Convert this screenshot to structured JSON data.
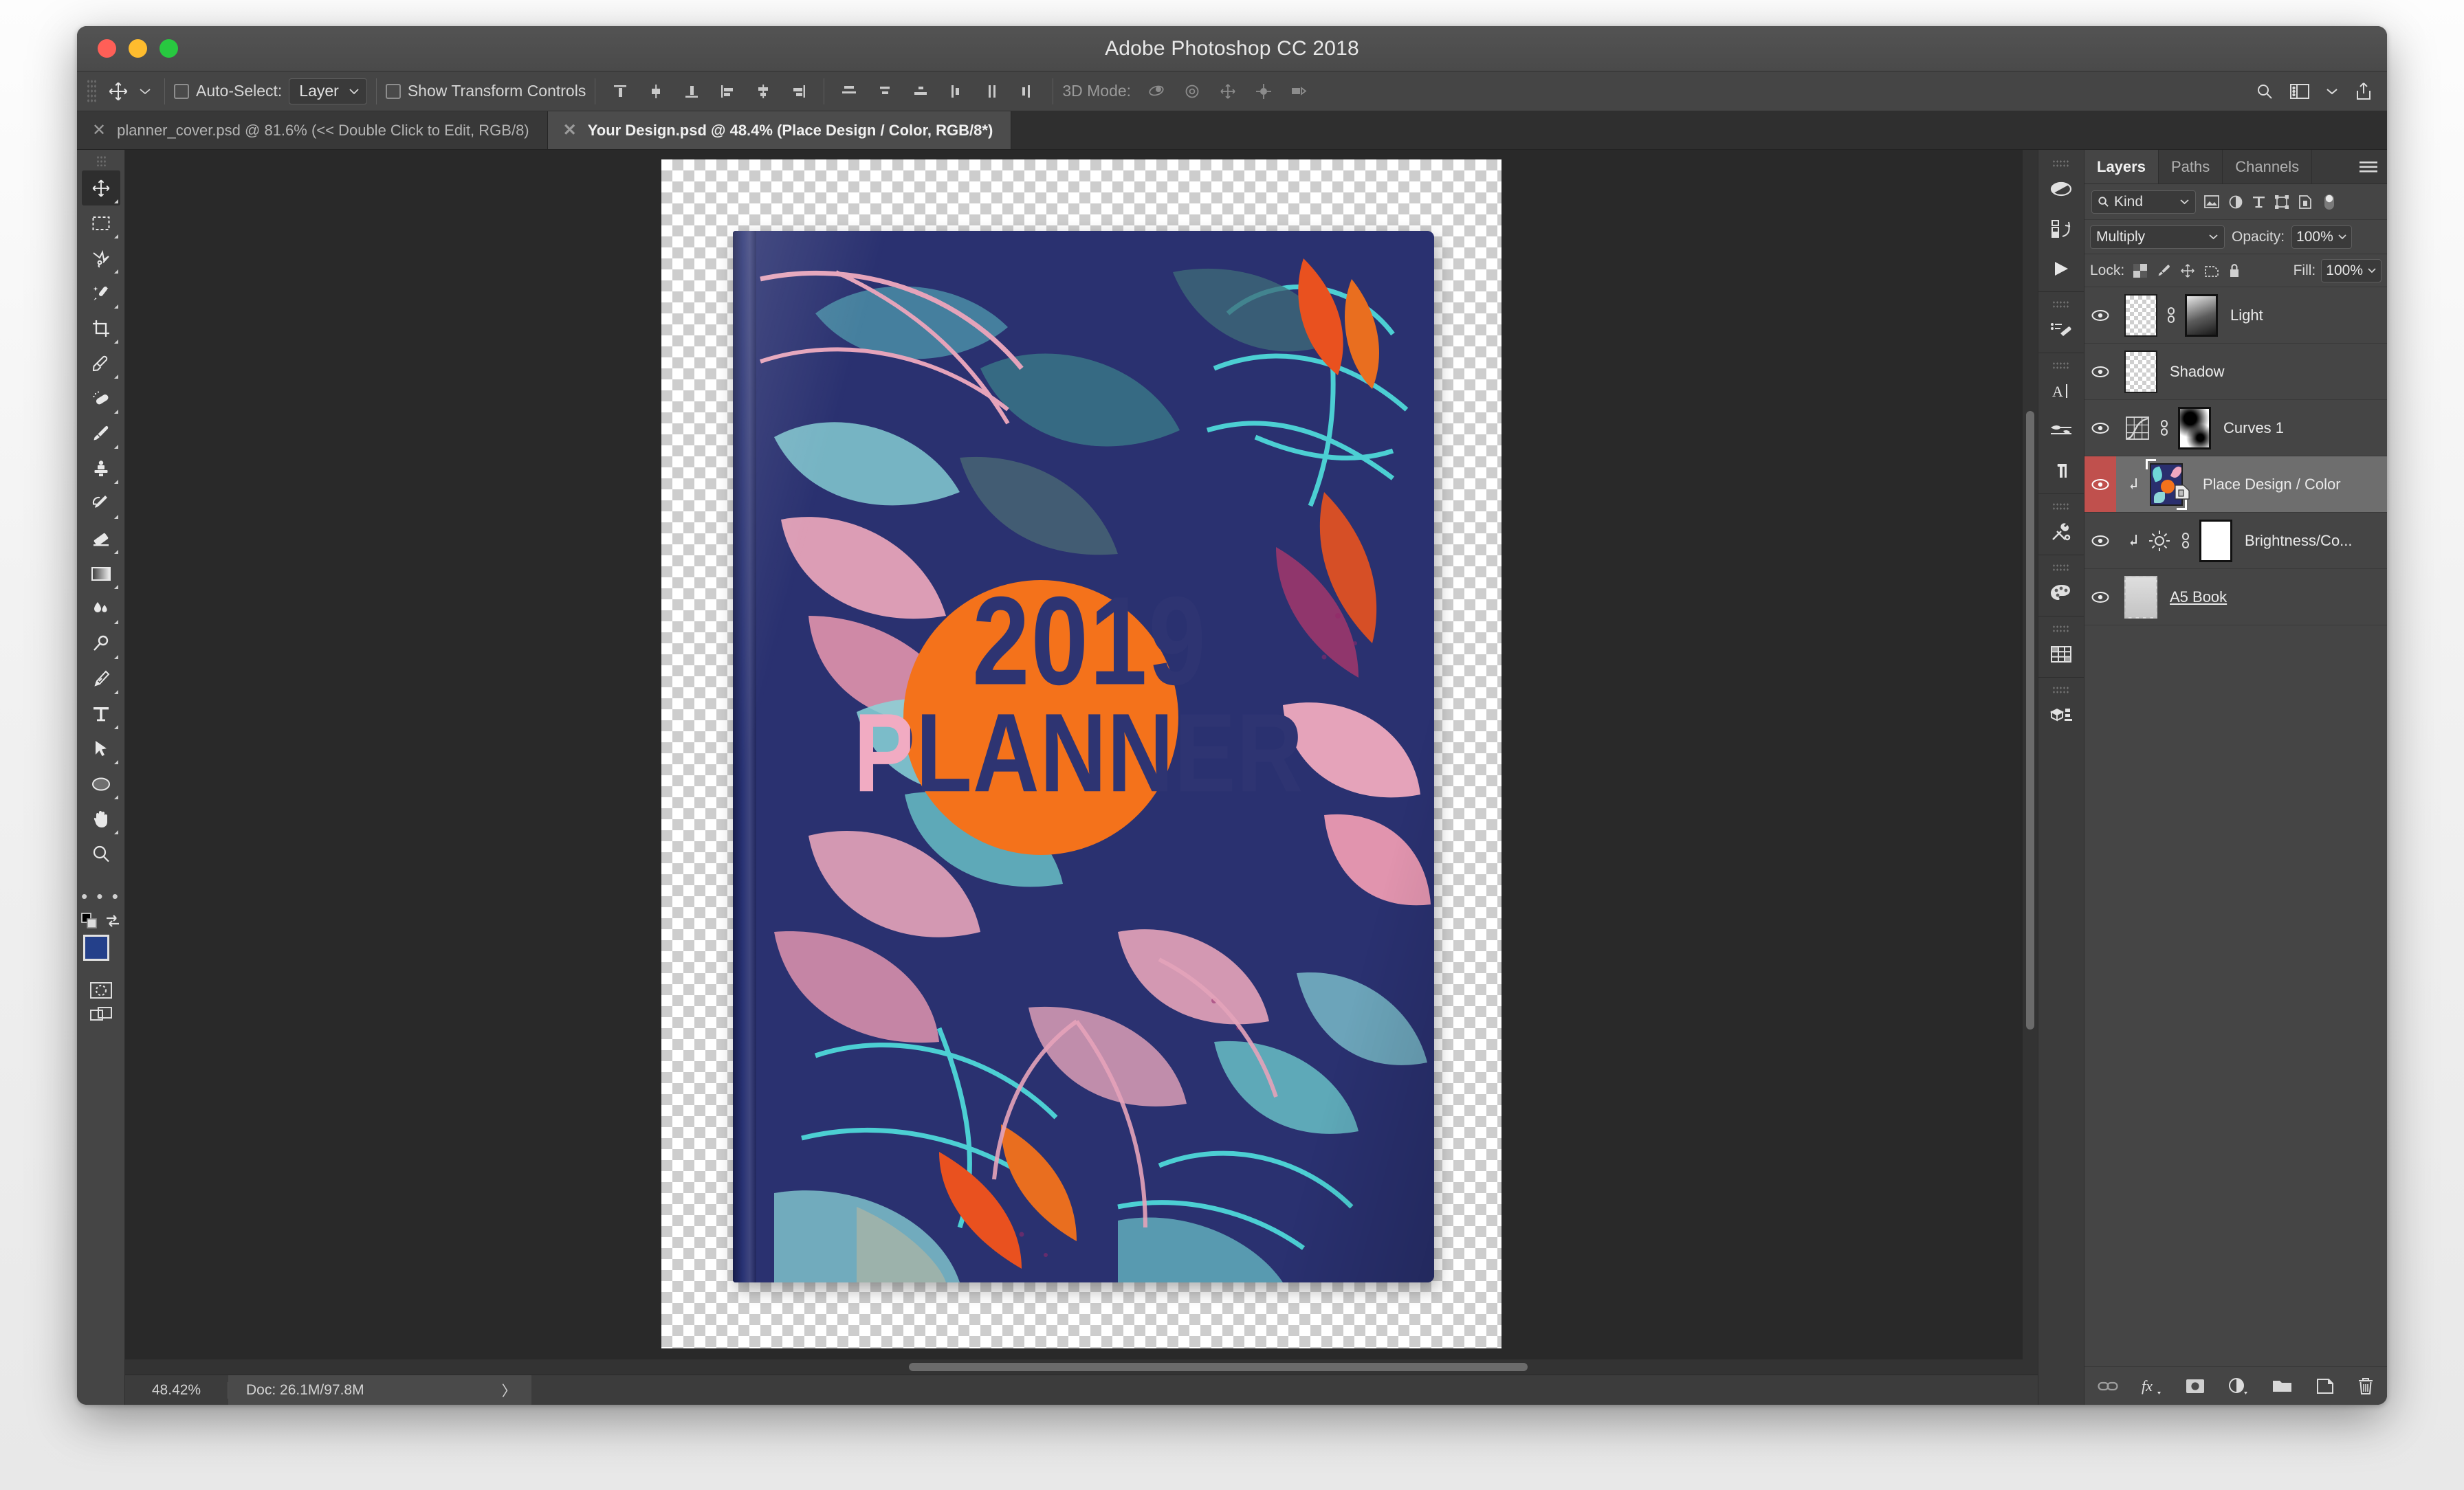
{
  "window": {
    "title": "Adobe Photoshop CC 2018",
    "traffic": {
      "close": "close-button",
      "minimize": "minimize-button",
      "zoom": "zoom-button"
    }
  },
  "options_bar": {
    "auto_select_label": "Auto-Select:",
    "auto_select_value": "Layer",
    "show_transform_label": "Show Transform Controls",
    "mode_3d_label": "3D Mode:",
    "align_icons": [
      "align-top-edges-icon",
      "align-vertical-centers-icon",
      "align-bottom-edges-icon",
      "align-left-edges-icon",
      "align-horizontal-centers-icon",
      "align-right-edges-icon"
    ],
    "distribute_icons": [
      "distribute-top-edges-icon",
      "distribute-vertical-centers-icon",
      "distribute-bottom-edges-icon",
      "distribute-left-edges-icon",
      "distribute-horizontal-centers-icon",
      "distribute-right-edges-icon"
    ],
    "mode_3d_icons": [
      "orbit-3d-icon",
      "roll-3d-icon",
      "pan-3d-icon",
      "slide-3d-icon",
      "camera-3d-icon"
    ],
    "right_icons": [
      "search-icon",
      "workspace-icon",
      "chevron-down-icon",
      "share-icon"
    ]
  },
  "tabs": [
    {
      "label": "planner_cover.psd @ 81.6% (<< Double Click to Edit, RGB/8)",
      "active": false
    },
    {
      "label": "Your Design.psd @ 48.4% (Place Design / Color, RGB/8*)",
      "active": true
    }
  ],
  "toolbar": {
    "tools": [
      {
        "name": "move-tool",
        "selected": true,
        "submenu": true
      },
      {
        "name": "rectangular-marquee-tool",
        "selected": false,
        "submenu": true
      },
      {
        "name": "lasso-tool",
        "selected": false,
        "submenu": true
      },
      {
        "name": "magic-wand-tool",
        "selected": false,
        "submenu": true
      },
      {
        "name": "crop-tool",
        "selected": false,
        "submenu": true
      },
      {
        "name": "eyedropper-tool",
        "selected": false,
        "submenu": true
      },
      {
        "name": "healing-brush-tool",
        "selected": false,
        "submenu": true
      },
      {
        "name": "brush-tool",
        "selected": false,
        "submenu": true
      },
      {
        "name": "clone-stamp-tool",
        "selected": false,
        "submenu": true
      },
      {
        "name": "history-brush-tool",
        "selected": false,
        "submenu": true
      },
      {
        "name": "eraser-tool",
        "selected": false,
        "submenu": true
      },
      {
        "name": "gradient-tool",
        "selected": false,
        "submenu": true
      },
      {
        "name": "blur-tool",
        "selected": false,
        "submenu": true
      },
      {
        "name": "dodge-tool",
        "selected": false,
        "submenu": true
      },
      {
        "name": "pen-tool",
        "selected": false,
        "submenu": true
      },
      {
        "name": "type-tool",
        "selected": false,
        "submenu": true
      },
      {
        "name": "path-selection-tool",
        "selected": false,
        "submenu": true
      },
      {
        "name": "ellipse-shape-tool",
        "selected": false,
        "submenu": true
      },
      {
        "name": "hand-tool",
        "selected": false,
        "submenu": true
      },
      {
        "name": "zoom-tool",
        "selected": false,
        "submenu": false
      }
    ],
    "more_tools": "• • •",
    "foreground_color": "#24408a",
    "background_color": "#000000",
    "quick_mask_icon": "quick-mask-icon",
    "screen_mode_icon": "screen-mode-icon",
    "swap_colors_icon": "swap-colors-icon",
    "default_colors_icon": "default-colors-icon"
  },
  "canvas": {
    "book_cover": {
      "title_year": "2019",
      "title_word": "PLANNER",
      "navy": "#2a3170",
      "orange": "#f4721b",
      "pink": "#f1abc2",
      "teal": "#6ad4d4"
    }
  },
  "status_bar": {
    "zoom": "48.42%",
    "doc_label": "Doc: 26.1M/97.8M",
    "expand_arrow": "〉"
  },
  "icon_dock": {
    "items": [
      "adjustments-panel-icon",
      "libraries-panel-icon",
      "actions-panel-icon",
      "brush-presets-panel-icon",
      "character-panel-icon",
      "brush-settings-panel-icon",
      "paragraph-panel-icon",
      "tool-presets-panel-icon",
      "color-panel-icon",
      "layer-comps-panel-icon",
      "3d-panel-icon"
    ]
  },
  "layers_panel": {
    "tabs": [
      {
        "label": "Layers",
        "active": true
      },
      {
        "label": "Paths",
        "active": false
      },
      {
        "label": "Channels",
        "active": false
      }
    ],
    "menu_icon": "panel-menu-icon",
    "filter": {
      "kind_label": "Kind",
      "search_icon": "search-icon",
      "filter_icons": [
        "pixel-layers-filter-icon",
        "adjustment-layers-filter-icon",
        "type-layers-filter-icon",
        "shape-layers-filter-icon",
        "smart-object-filter-icon"
      ],
      "toggle": "filter-toggle"
    },
    "blend_mode": "Multiply",
    "opacity_label": "Opacity:",
    "opacity_value": "100%",
    "lock_label": "Lock:",
    "lock_icons": [
      "lock-transparent-pixels-icon",
      "lock-image-pixels-icon",
      "lock-position-icon",
      "lock-artboard-nesting-icon",
      "lock-all-icon"
    ],
    "fill_label": "Fill:",
    "fill_value": "100%",
    "layers": [
      {
        "name": "Light",
        "visible": true,
        "selected": false,
        "thumb": "transparent",
        "mask": "gradient",
        "linked": true,
        "clipped": false,
        "underline": false
      },
      {
        "name": "Shadow",
        "visible": true,
        "selected": false,
        "thumb": "transparent",
        "mask": null,
        "linked": false,
        "clipped": false,
        "underline": false
      },
      {
        "name": "Curves 1",
        "visible": true,
        "selected": false,
        "thumb": "curves",
        "mask": "curvemask",
        "linked": true,
        "clipped": false,
        "underline": false
      },
      {
        "name": "Place Design / Color",
        "visible": true,
        "selected": true,
        "thumb": "design",
        "mask": null,
        "linked": false,
        "clipped": true,
        "underline": false
      },
      {
        "name": "Brightness/Co...",
        "visible": true,
        "selected": false,
        "thumb": "brightness",
        "mask": "white",
        "linked": true,
        "clipped": true,
        "underline": false
      },
      {
        "name": "A5 Book",
        "visible": true,
        "selected": false,
        "thumb": "a5",
        "mask": null,
        "linked": false,
        "clipped": false,
        "underline": true
      }
    ],
    "footer_icons": [
      "link-layers-icon",
      "layer-style-fx-icon",
      "add-layer-mask-icon",
      "new-adjustment-layer-icon",
      "new-group-icon",
      "new-layer-icon",
      "delete-layer-icon"
    ]
  }
}
